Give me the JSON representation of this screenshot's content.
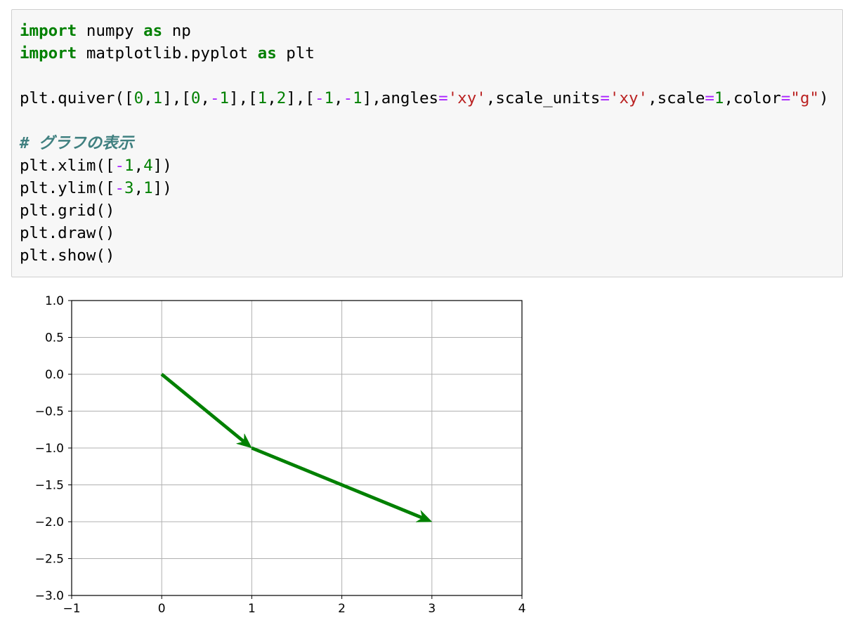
{
  "code_cell": {
    "lines": [
      [
        {
          "t": "import",
          "c": "kw"
        },
        {
          "t": " numpy ",
          "c": ""
        },
        {
          "t": "as",
          "c": "kw"
        },
        {
          "t": " np",
          "c": ""
        }
      ],
      [
        {
          "t": "import",
          "c": "kw"
        },
        {
          "t": " matplotlib.pyplot ",
          "c": ""
        },
        {
          "t": "as",
          "c": "kw"
        },
        {
          "t": " plt",
          "c": ""
        }
      ],
      [],
      [
        {
          "t": "plt.quiver([",
          "c": ""
        },
        {
          "t": "0",
          "c": "num"
        },
        {
          "t": ",",
          "c": ""
        },
        {
          "t": "1",
          "c": "num"
        },
        {
          "t": "],[",
          "c": ""
        },
        {
          "t": "0",
          "c": "num"
        },
        {
          "t": ",",
          "c": ""
        },
        {
          "t": "-",
          "c": "op"
        },
        {
          "t": "1",
          "c": "num"
        },
        {
          "t": "],[",
          "c": ""
        },
        {
          "t": "1",
          "c": "num"
        },
        {
          "t": ",",
          "c": ""
        },
        {
          "t": "2",
          "c": "num"
        },
        {
          "t": "],[",
          "c": ""
        },
        {
          "t": "-",
          "c": "op"
        },
        {
          "t": "1",
          "c": "num"
        },
        {
          "t": ",",
          "c": ""
        },
        {
          "t": "-",
          "c": "op"
        },
        {
          "t": "1",
          "c": "num"
        },
        {
          "t": "],angles",
          "c": ""
        },
        {
          "t": "=",
          "c": "op"
        },
        {
          "t": "'xy'",
          "c": "str"
        },
        {
          "t": ",scale_units",
          "c": ""
        },
        {
          "t": "=",
          "c": "op"
        },
        {
          "t": "'xy'",
          "c": "str"
        },
        {
          "t": ",scale",
          "c": ""
        },
        {
          "t": "=",
          "c": "op"
        },
        {
          "t": "1",
          "c": "num"
        },
        {
          "t": ",color",
          "c": ""
        },
        {
          "t": "=",
          "c": "op"
        },
        {
          "t": "\"g\"",
          "c": "str"
        },
        {
          "t": ")",
          "c": ""
        }
      ],
      [],
      [
        {
          "t": "# グラフの表示",
          "c": "cmt"
        }
      ],
      [
        {
          "t": "plt.xlim([",
          "c": ""
        },
        {
          "t": "-",
          "c": "op"
        },
        {
          "t": "1",
          "c": "num"
        },
        {
          "t": ",",
          "c": ""
        },
        {
          "t": "4",
          "c": "num"
        },
        {
          "t": "])",
          "c": ""
        }
      ],
      [
        {
          "t": "plt.ylim([",
          "c": ""
        },
        {
          "t": "-",
          "c": "op"
        },
        {
          "t": "3",
          "c": "num"
        },
        {
          "t": ",",
          "c": ""
        },
        {
          "t": "1",
          "c": "num"
        },
        {
          "t": "])",
          "c": ""
        }
      ],
      [
        {
          "t": "plt.grid()",
          "c": ""
        }
      ],
      [
        {
          "t": "plt.draw()",
          "c": ""
        }
      ],
      [
        {
          "t": "plt.show()",
          "c": ""
        }
      ]
    ]
  },
  "colors": {
    "keyword": "#008000",
    "number": "#008000",
    "operator": "#aa22ff",
    "string": "#ba2121",
    "comment": "#408080",
    "arrow": "#008000"
  },
  "chart_data": {
    "type": "quiver",
    "arrows": [
      {
        "x": 0,
        "y": 0,
        "u": 1,
        "v": -1
      },
      {
        "x": 1,
        "y": -1,
        "u": 2,
        "v": -1
      }
    ],
    "color": "#008000",
    "xlim": [
      -1,
      4
    ],
    "ylim": [
      -3,
      1
    ],
    "grid": true,
    "xticks": [
      -1,
      0,
      1,
      2,
      3,
      4
    ],
    "xtick_labels": [
      "−1",
      "0",
      "1",
      "2",
      "3",
      "4"
    ],
    "yticks": [
      1.0,
      0.5,
      0.0,
      -0.5,
      -1.0,
      -1.5,
      -2.0,
      -2.5,
      -3.0
    ],
    "ytick_labels": [
      "1.0",
      "0.5",
      "0.0",
      "−0.5",
      "−1.0",
      "−1.5",
      "−2.0",
      "−2.5",
      "−3.0"
    ]
  }
}
